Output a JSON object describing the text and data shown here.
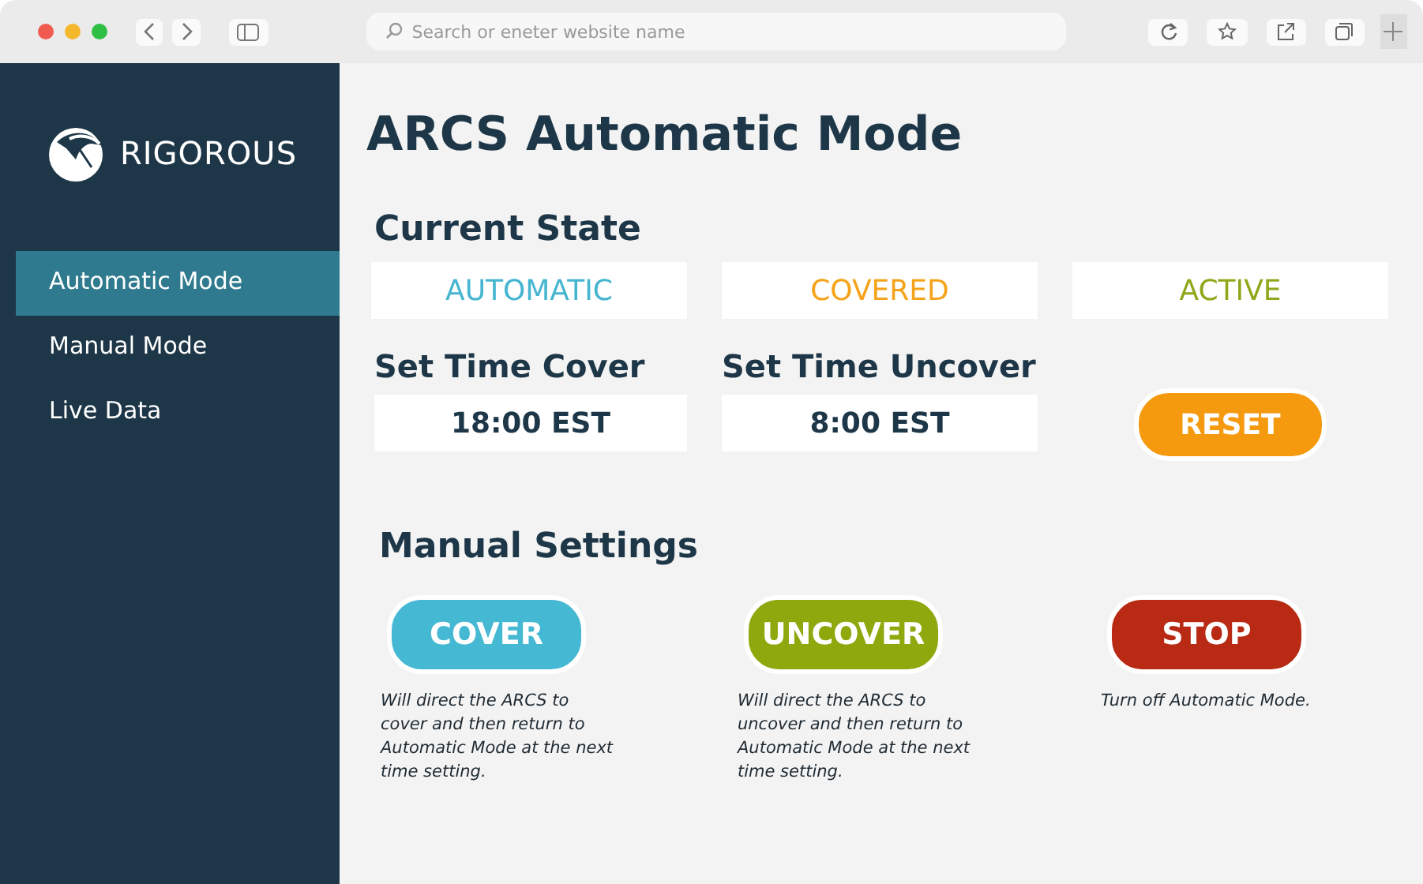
{
  "browser": {
    "search_placeholder": "Search or eneter website name"
  },
  "sidebar": {
    "brand": "RIGOROUS",
    "items": [
      {
        "label": "Automatic Mode",
        "selected": true
      },
      {
        "label": "Manual Mode",
        "selected": false
      },
      {
        "label": "Live Data",
        "selected": false
      }
    ]
  },
  "title": "ARCS Automatic Mode",
  "current_state": {
    "heading": "Current State",
    "values": [
      {
        "text": "AUTOMATIC",
        "color": "#45b5d0"
      },
      {
        "text": "COVERED",
        "color": "#f5a31a"
      },
      {
        "text": "ACTIVE",
        "color": "#8fa81a"
      }
    ]
  },
  "times": [
    {
      "heading": "Set Time Cover",
      "value": "18:00 EST"
    },
    {
      "heading": "Set Time Uncover",
      "value": "8:00 EST"
    }
  ],
  "reset_button": {
    "label": "RESET",
    "color": "#f59a0e"
  },
  "manual": {
    "heading": "Manual Settings",
    "actions": [
      {
        "label": "COVER",
        "color": "#45b8d3",
        "description": "Will direct the ARCS to cover and then return to Automatic Mode at the next time setting."
      },
      {
        "label": "UNCOVER",
        "color": "#8ea80d",
        "description": "Will direct the ARCS to uncover and then return to Automatic Mode at the next time setting."
      },
      {
        "label": "STOP",
        "color": "#b82a14",
        "description": "Turn off Automatic Mode."
      }
    ]
  }
}
